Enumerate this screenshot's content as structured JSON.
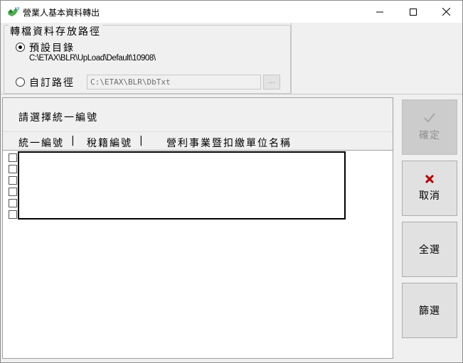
{
  "window": {
    "title": "營業人基本資料轉出"
  },
  "path_group": {
    "legend": "轉檔資料存放路徑",
    "default_option": {
      "label": "預設目錄",
      "path": "C:\\ETAX\\BLR\\UpLoad\\Default\\10908\\",
      "checked": true
    },
    "custom_option": {
      "label": "自訂路徑",
      "value": "C:\\ETAX\\BLR\\DbTxt",
      "checked": false
    },
    "browse_label": "..."
  },
  "list_panel": {
    "title": "請選擇統一編號",
    "columns": [
      "統一編號",
      "稅籍編號",
      "營利事業暨扣繳單位名稱"
    ],
    "separator": "|",
    "row_count": 6
  },
  "side_buttons": {
    "ok": {
      "label": "確定",
      "icon": "checkmark-icon",
      "enabled": false
    },
    "cancel": {
      "label": "取消",
      "icon": "x-icon",
      "icon_color": "#b30000",
      "enabled": true
    },
    "select_all": {
      "label": "全選",
      "enabled": true
    },
    "filter": {
      "label": "篩選",
      "enabled": true
    }
  }
}
